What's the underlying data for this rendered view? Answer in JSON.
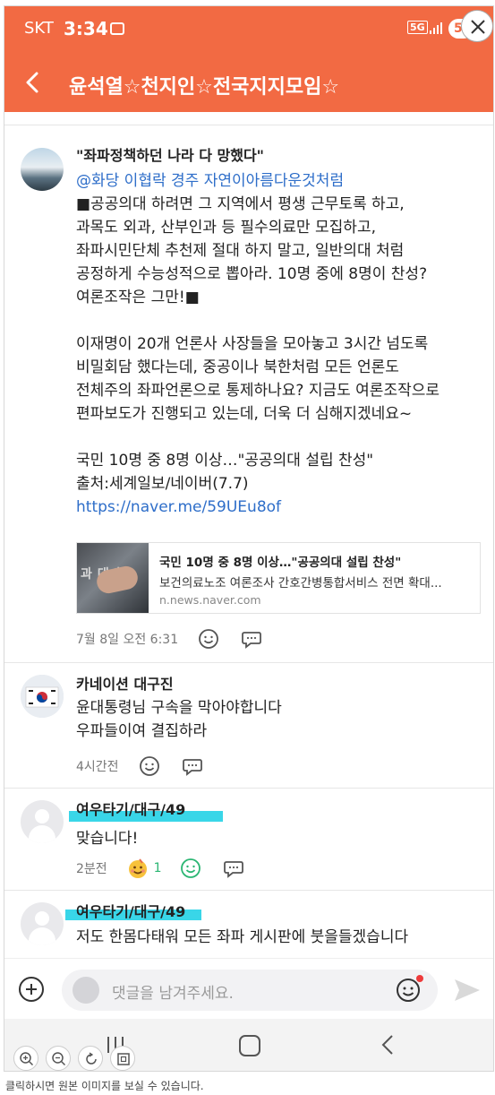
{
  "status_bar": {
    "carrier": "SKT",
    "time": "3:34",
    "network": "5G",
    "battery": "5"
  },
  "header": {
    "title": "윤석열☆천지인☆전국지지모임☆"
  },
  "post": {
    "headline": "\"좌파정책하던 나라 다 망했다\"",
    "mention": "@화당  이협락  경주    자연이아름다운것처럼",
    "lines": [
      "■공공의대 하려면 그 지역에서 평생 근무토록 하고,",
      "과목도 외과, 산부인과 등 필수의료만 모집하고,",
      "좌파시민단체 추천제 절대 하지 말고, 일반의대 처럼",
      "공정하게 수능성적으로 뽑아라. 10명 중에 8명이 찬성?",
      "여론조작은 그만!■",
      "",
      "이재명이 20개 언론사 사장들을 모아놓고 3시간 넘도록",
      "비밀회담 했다는데, 중공이나 북한처럼 모든 언론도",
      "전체주의 좌파언론으로 통제하나요? 지금도 여론조작으로",
      "편파보도가 진행되고 있는데, 더욱 더 심해지겠네요~",
      "",
      "국민 10명 중 8명 이상…\"공공의대 설립 찬성\"",
      "출처:세계일보/네이버(7.7)"
    ],
    "url": "https://naver.me/59UEu8of",
    "link_card": {
      "title": "국민 10명 중 8명 이상…\"공공의대 설립 찬성\"",
      "description": "보건의료노조 여론조사 간호간병통합서비스 전면 확대...",
      "domain": "n.news.naver.com"
    },
    "timestamp": "7월 8일 오전 6:31"
  },
  "comments": [
    {
      "author": "카네이션 대구진",
      "lines": [
        "윤대통령님 구속을 막아야합니다",
        "우파들이여 결집하라"
      ],
      "time": "4시간전",
      "reaction_count": ""
    },
    {
      "author": "여우타기/대구/49",
      "lines": [
        "맞습니다!"
      ],
      "time": "2분전",
      "reaction_count": "1"
    },
    {
      "author": "여우타기/대구/49",
      "lines": [
        "저도 한몸다태워 모든 좌파 게시판에 붓을들겠습니다"
      ],
      "time": "",
      "reaction_count": ""
    }
  ],
  "composer": {
    "placeholder": "댓글을 남겨주세요."
  },
  "caption": "클릭하시면 원본 이미지를 보실 수 있습니다.",
  "colors": {
    "header_bg": "#f26a43",
    "link": "#2e6ec9",
    "highlight": "#39d6e8",
    "reaction_green": "#2bb673"
  },
  "icons": [
    "back-arrow-icon",
    "close-icon",
    "smile-icon",
    "speech-bubble-icon",
    "emoji-icon",
    "plus-icon",
    "send-icon",
    "home-icon",
    "recent-apps-icon",
    "zoom-in-icon",
    "zoom-out-icon"
  ]
}
